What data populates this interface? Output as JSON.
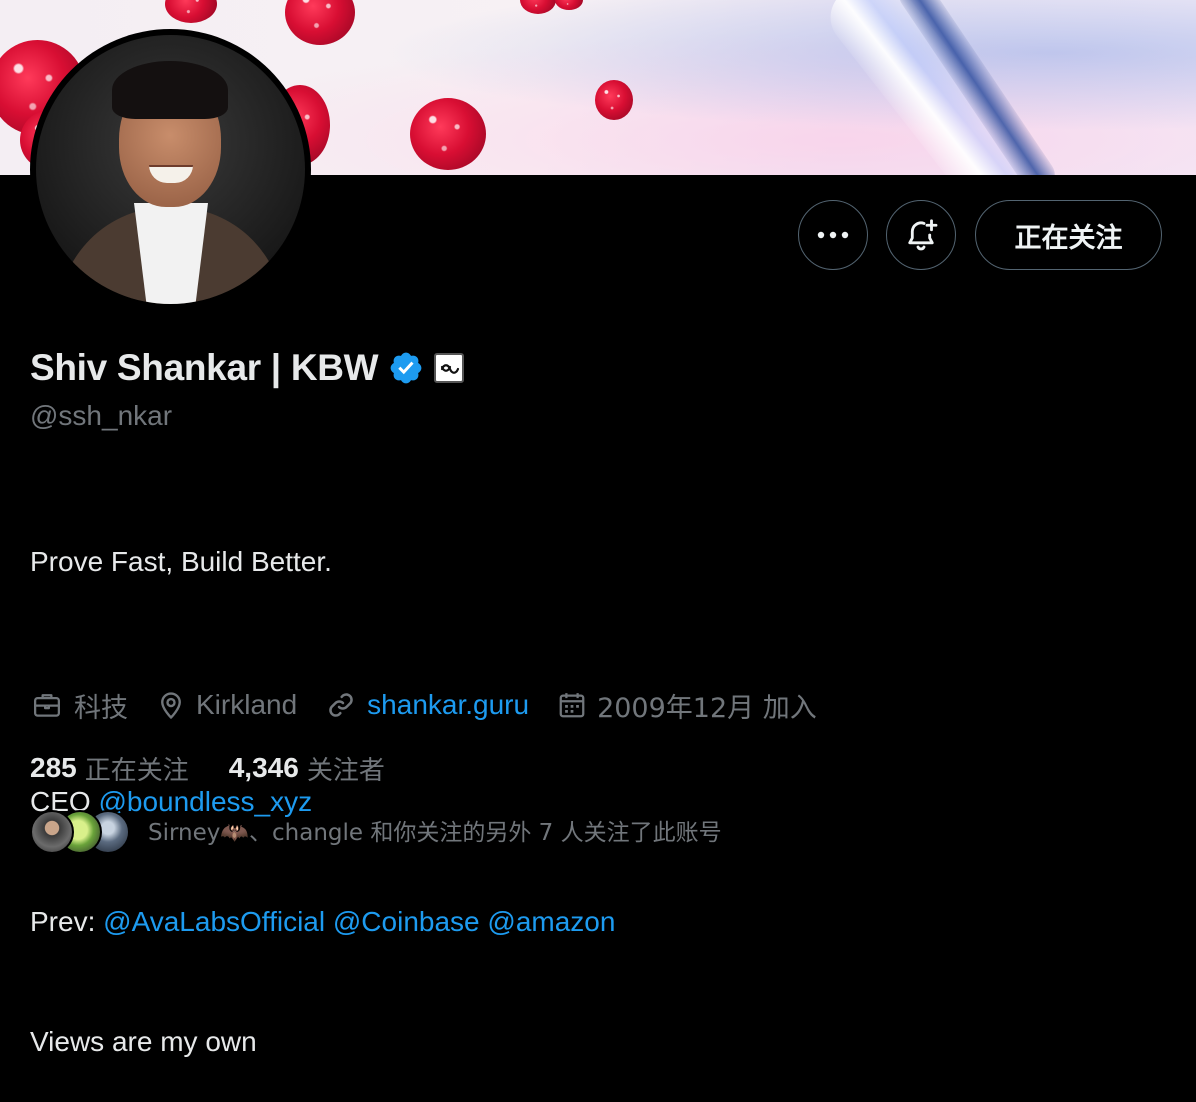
{
  "profile": {
    "display_name": "Shiv Shankar | KBW",
    "handle": "@ssh_nkar",
    "verified": true
  },
  "actions": {
    "more_icon": "more-horizontal-icon",
    "notify_icon": "bell-plus-icon",
    "follow_status_label": "正在关注"
  },
  "bio": {
    "line1": "Prove Fast, Build Better.",
    "line3_prefix": "CEO ",
    "line3_mention": "@boundless_xyz",
    "line4_prefix": "Prev: ",
    "line4_mentions": [
      "@AvaLabsOfficial",
      "@Coinbase",
      "@amazon"
    ],
    "line5": "Views are my own"
  },
  "meta": {
    "category": "科技",
    "location": "Kirkland",
    "website": "shankar.guru",
    "joined": "2009年12月 加入"
  },
  "stats": {
    "following_count": "285",
    "following_label": "正在关注",
    "followers_count": "4,346",
    "followers_label": "关注者"
  },
  "followed_by": {
    "text": "Sirney🦇、changle 和你关注的另外 7 人关注了此账号"
  },
  "colors": {
    "background": "#000000",
    "text_primary": "#e7e9ea",
    "text_secondary": "#71767b",
    "link": "#1d9bf0",
    "verified_badge": "#1d9bf0",
    "button_border": "#536471"
  }
}
